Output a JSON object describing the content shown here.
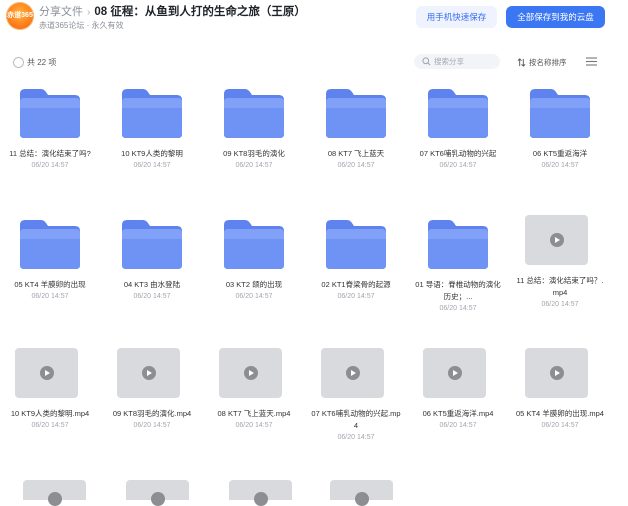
{
  "header": {
    "logo_text": "赤道365",
    "breadcrumb_root": "分享文件",
    "breadcrumb_sep": "›",
    "title": "08 征程：从鱼到人打的生命之旅（王原）",
    "meta": "赤道365论坛 · 永久有效",
    "phone_save_label": "用手机快速保存",
    "save_all_label": "全部保存到我的云盘"
  },
  "toolbar": {
    "count_label": "共 22 项",
    "search_placeholder": "搜索分享",
    "sort_label": "按名称排序"
  },
  "colors": {
    "folder": "#6f93f5",
    "primary_button": "#3b77f3",
    "video_thumb": "#d9dadd"
  },
  "items": [
    {
      "type": "folder",
      "name": "11 总结：演化结束了吗?",
      "date": "06/20 14:57"
    },
    {
      "type": "folder",
      "name": "10 KT9人类的黎明",
      "date": "06/20 14:57"
    },
    {
      "type": "folder",
      "name": "09 KT8羽毛的演化",
      "date": "06/20 14:57"
    },
    {
      "type": "folder",
      "name": "08 KT7 飞上蓝天",
      "date": "06/20 14:57"
    },
    {
      "type": "folder",
      "name": "07 KT6哺乳动物的兴起",
      "date": "06/20 14:57"
    },
    {
      "type": "folder",
      "name": "06 KT5重返海洋",
      "date": "06/20 14:57"
    },
    {
      "type": "folder",
      "name": "05 KT4 羊膜卵的出现",
      "date": "06/20 14:57"
    },
    {
      "type": "folder",
      "name": "04 KT3 由水登陆",
      "date": "06/20 14:57"
    },
    {
      "type": "folder",
      "name": "03 KT2 颌的出现",
      "date": "06/20 14:57"
    },
    {
      "type": "folder",
      "name": "02 KT1脊梁骨的起源",
      "date": "06/20 14:57"
    },
    {
      "type": "folder",
      "name": "01 导语：脊椎动物的演化历史；...",
      "date": "06/20 14:57"
    },
    {
      "type": "video",
      "name": "11 总结：演化结束了吗？.mp4",
      "date": "06/20 14:57"
    },
    {
      "type": "video",
      "name": "10 KT9人类的黎明.mp4",
      "date": "06/20 14:57"
    },
    {
      "type": "video",
      "name": "09 KT8羽毛的演化.mp4",
      "date": "06/20 14:57"
    },
    {
      "type": "video",
      "name": "08 KT7 飞上蓝天.mp4",
      "date": "06/20 14:57"
    },
    {
      "type": "video",
      "name": "07 KT6哺乳动物的兴起.mp4",
      "date": "06/20 14:57"
    },
    {
      "type": "video",
      "name": "06 KT5重返海洋.mp4",
      "date": "06/20 14:57"
    },
    {
      "type": "video",
      "name": "05 KT4 羊膜卵的出现.mp4",
      "date": "06/20 14:57"
    }
  ]
}
